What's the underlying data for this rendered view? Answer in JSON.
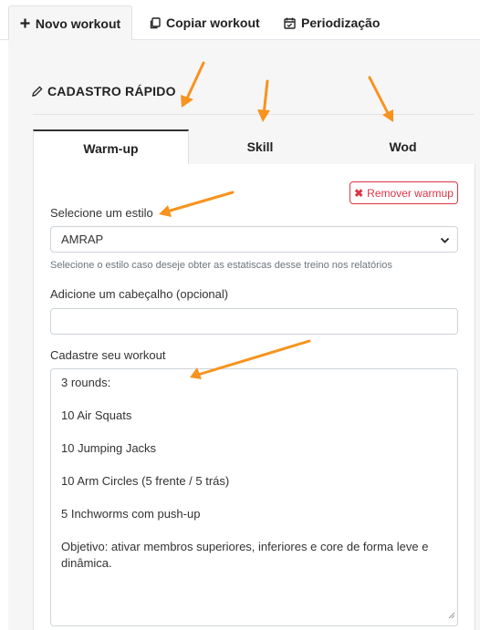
{
  "top_tabs": [
    {
      "label": "Novo workout"
    },
    {
      "label": "Copiar workout"
    },
    {
      "label": "Periodização"
    }
  ],
  "section": {
    "title": "CADASTRO RÁPIDO"
  },
  "sub_tabs": [
    {
      "label": "Warm-up"
    },
    {
      "label": "Skill"
    },
    {
      "label": "Wod"
    }
  ],
  "remove_button": {
    "label": "Remover warmup"
  },
  "style_field": {
    "label": "Selecione um estilo",
    "value": "AMRAP",
    "help": "Selecione o estilo caso deseje obter as estatiscas desse treino nos relatórios"
  },
  "header_field": {
    "label": "Adicione um cabeçalho (opcional)",
    "value": ""
  },
  "workout_field": {
    "label": "Cadastre seu workout",
    "lines": [
      "3 rounds:",
      "",
      "10 Air Squats",
      "",
      "10 Jumping Jacks",
      "",
      "10 Arm Circles (5 frente / 5 trás)",
      "",
      "5 Inchworms com push-up",
      "",
      "Objetivo: ativar membros superiores, inferiores e core de forma leve e",
      "dinâmica."
    ]
  },
  "colors": {
    "accent": "#f7931e",
    "danger": "#dc3545",
    "panel_bg": "#f6f6f6"
  }
}
